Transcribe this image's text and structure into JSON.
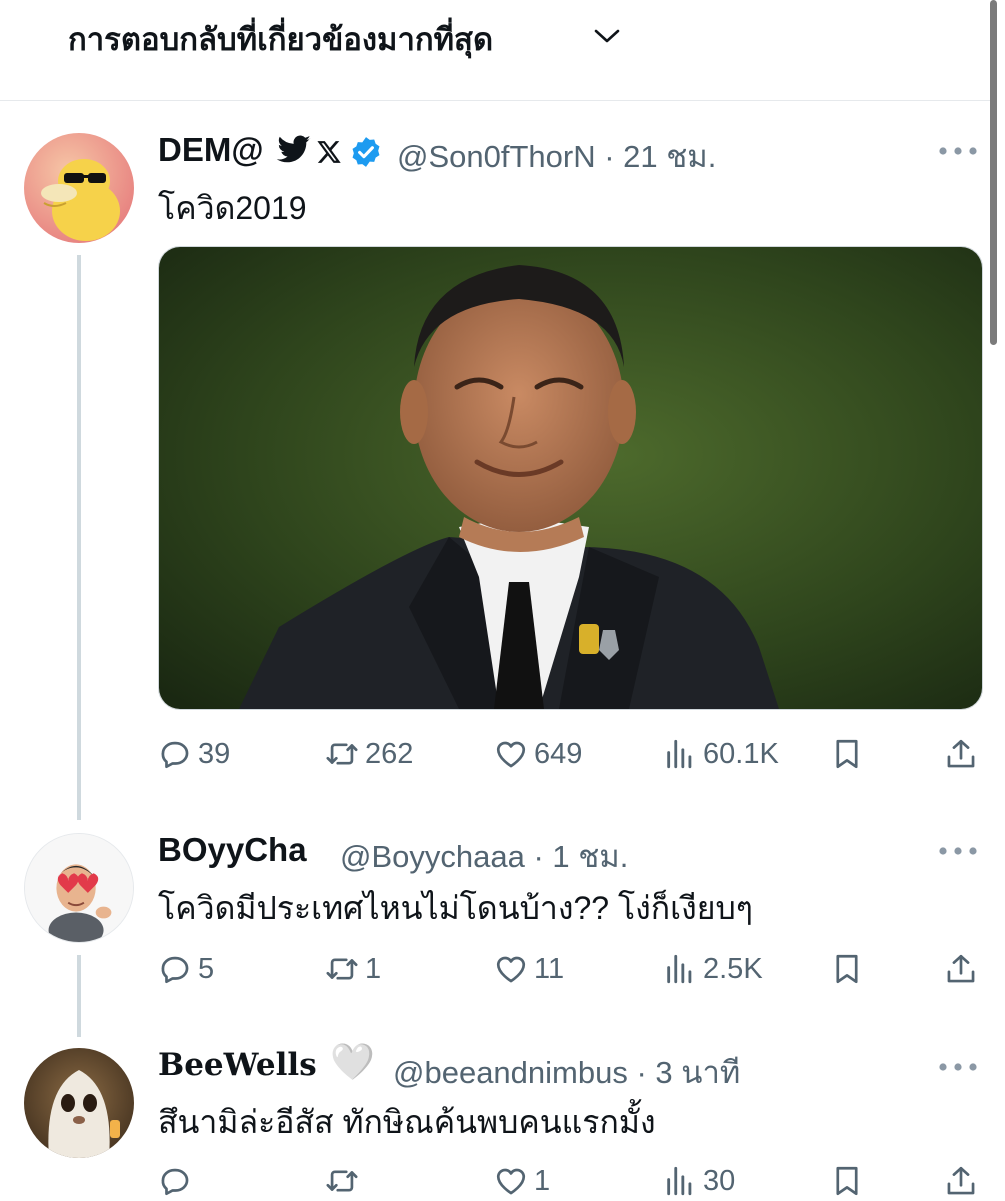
{
  "header": {
    "title": "การตอบกลับที่เกี่ยวข้องมากที่สุด"
  },
  "tweets": [
    {
      "name": "DEM@",
      "handle_time": "@Son0fThorN · 21 ชม.",
      "text": "โควิด2019",
      "has_media": true,
      "stats": {
        "replies": "39",
        "retweets": "262",
        "likes": "649",
        "views": "60.1K"
      }
    },
    {
      "name": "BOyyCha",
      "handle_time": "@Boyychaaa · 1 ชม.",
      "text": "โควิดมีประเทศไหนไม่โดนบ้าง?? โง่ก็เงียบๆ",
      "stats": {
        "replies": "5",
        "retweets": "1",
        "likes": "11",
        "views": "2.5K"
      }
    },
    {
      "name": "BeeWells",
      "name_emoji": "🤍",
      "handle_time": "@beeandnimbus · 3 นาที",
      "text": "สึนามิล่ะอีสัส ทักษิณค้นพบคนแรกมั้ง",
      "stats": {
        "replies": "",
        "retweets": "",
        "likes": "1",
        "views": "30"
      }
    }
  ],
  "colors": {
    "secondary": "#536471",
    "verified": "#1d9bf0",
    "divider": "#cfd9de"
  },
  "icons": [
    "chevron-down-icon",
    "more-icon",
    "reply-icon",
    "retweet-icon",
    "like-icon",
    "views-icon",
    "bookmark-icon",
    "share-icon",
    "verified-icon",
    "bird-icon",
    "x-logo-icon"
  ]
}
